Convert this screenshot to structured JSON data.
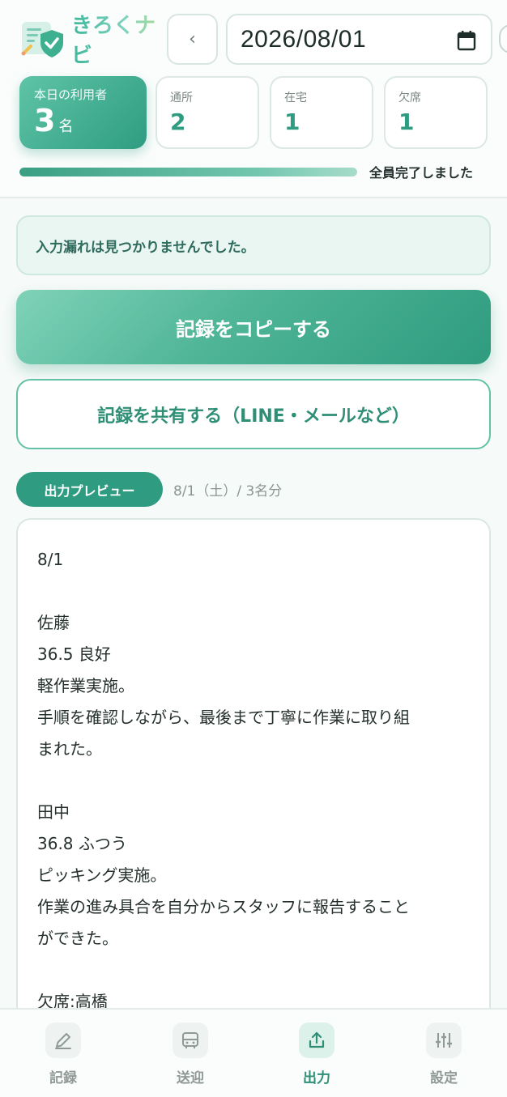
{
  "app": {
    "name": "きろくナビ"
  },
  "header": {
    "prev_label": "‹",
    "date": "2026/08/01",
    "stats": {
      "total": {
        "label": "本日の利用者",
        "value": "3",
        "unit": "名"
      },
      "commute": {
        "label": "通所",
        "value": "2"
      },
      "home": {
        "label": "在宅",
        "value": "1"
      },
      "absent": {
        "label": "欠席",
        "value": "1"
      }
    },
    "progress": {
      "percent": 100,
      "label": "全員完了しました"
    }
  },
  "main": {
    "notice": "入力漏れは見つかりませんでした。",
    "copy_button": "記録をコピーする",
    "share_button": "記録を共有する（LINE・メールなど）",
    "preview_badge": "出力プレビュー",
    "preview_meta": "8/1（土）/ 3名分",
    "preview_lines": [
      "8/1",
      "",
      "佐藤",
      "36.5 良好",
      "軽作業実施。",
      "手順を確認しながら、最後まで丁寧に作業に取り組",
      "まれた。",
      "",
      "田中",
      "36.8 ふつう",
      "ピッキング実施。",
      "作業の進み具合を自分からスタッフに報告すること",
      "ができた。",
      "",
      "欠席:高橋"
    ]
  },
  "nav": {
    "items": [
      {
        "label": "記録",
        "icon": "pencil-icon"
      },
      {
        "label": "送迎",
        "icon": "bus-icon"
      },
      {
        "label": "出力",
        "icon": "upload-icon",
        "active": true
      },
      {
        "label": "設定",
        "icon": "sliders-icon"
      }
    ]
  },
  "colors": {
    "accent": "#2f9c81",
    "accent_light": "#e9f6f1"
  }
}
